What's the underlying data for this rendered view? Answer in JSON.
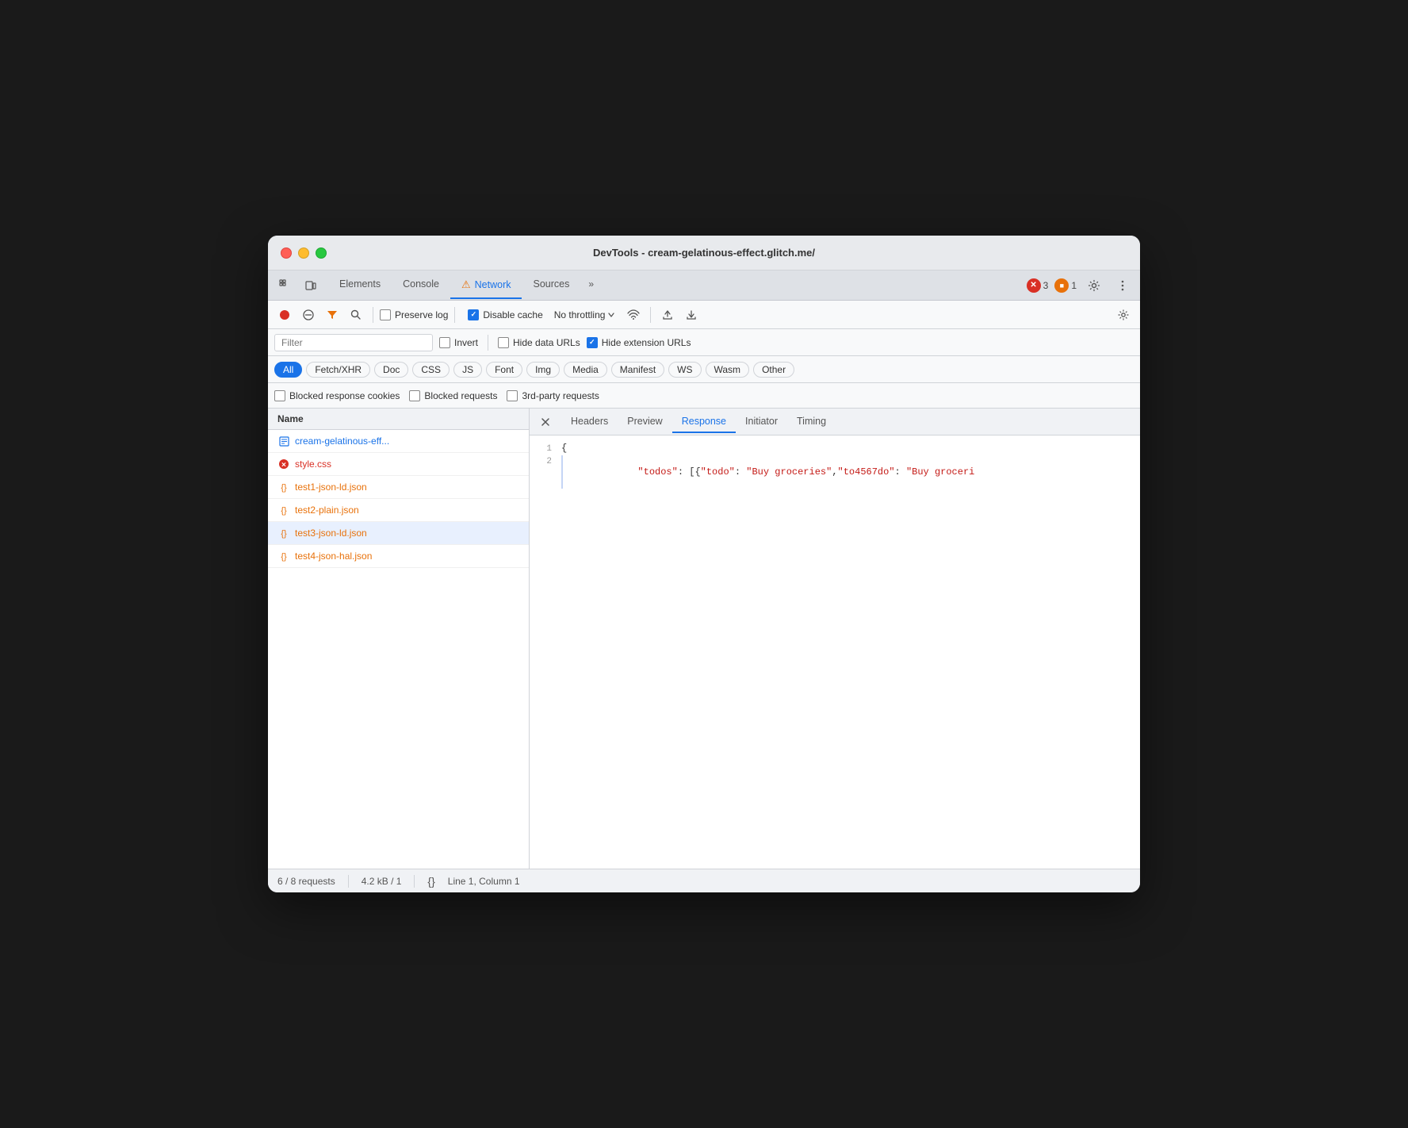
{
  "window": {
    "title": "DevTools - cream-gelatinous-effect.glitch.me/"
  },
  "tabs": {
    "items": [
      {
        "label": "Elements",
        "active": false
      },
      {
        "label": "Console",
        "active": false
      },
      {
        "label": "Network",
        "active": true
      },
      {
        "label": "Sources",
        "active": false
      }
    ],
    "more_label": "»",
    "error_count": "3",
    "warning_count": "1"
  },
  "toolbar": {
    "preserve_log": "Preserve log",
    "disable_cache": "Disable cache",
    "no_throttling": "No throttling",
    "preserve_log_checked": false,
    "disable_cache_checked": true
  },
  "filter_bar": {
    "filter_placeholder": "Filter",
    "invert_label": "Invert",
    "invert_checked": false,
    "hide_data_label": "Hide data URLs",
    "hide_data_checked": false,
    "hide_ext_label": "Hide extension URLs",
    "hide_ext_checked": true
  },
  "type_filters": {
    "items": [
      {
        "label": "All",
        "active": true
      },
      {
        "label": "Fetch/XHR",
        "active": false
      },
      {
        "label": "Doc",
        "active": false
      },
      {
        "label": "CSS",
        "active": false
      },
      {
        "label": "JS",
        "active": false
      },
      {
        "label": "Font",
        "active": false
      },
      {
        "label": "Img",
        "active": false
      },
      {
        "label": "Media",
        "active": false
      },
      {
        "label": "Manifest",
        "active": false
      },
      {
        "label": "WS",
        "active": false
      },
      {
        "label": "Wasm",
        "active": false
      },
      {
        "label": "Other",
        "active": false
      }
    ]
  },
  "extra_filters": {
    "blocked_cookies": "Blocked response cookies",
    "blocked_requests": "Blocked requests",
    "third_party": "3rd-party requests",
    "blocked_cookies_checked": false,
    "blocked_requests_checked": false,
    "third_party_checked": false
  },
  "file_list": {
    "header": "Name",
    "items": [
      {
        "name": "cream-gelatinous-eff...",
        "type": "doc",
        "selected": false
      },
      {
        "name": "style.css",
        "type": "error",
        "selected": false
      },
      {
        "name": "test1-json-ld.json",
        "type": "json",
        "selected": false
      },
      {
        "name": "test2-plain.json",
        "type": "json",
        "selected": false
      },
      {
        "name": "test3-json-ld.json",
        "type": "json",
        "selected": true
      },
      {
        "name": "test4-json-hal.json",
        "type": "json",
        "selected": false
      }
    ]
  },
  "response_panel": {
    "tabs": [
      {
        "label": "Headers",
        "active": false
      },
      {
        "label": "Preview",
        "active": false
      },
      {
        "label": "Response",
        "active": true
      },
      {
        "label": "Initiator",
        "active": false
      },
      {
        "label": "Timing",
        "active": false
      }
    ],
    "code_lines": [
      {
        "number": "1",
        "indent": false,
        "text": "{"
      },
      {
        "number": "2",
        "indent": true,
        "text": "  \"todos\": [{\"todo\": \"Buy groceries\",\"to4567do\": \"Buy groceri"
      }
    ]
  },
  "status_bar": {
    "requests": "6 / 8 requests",
    "size": "4.2 kB / 1",
    "position": "Line 1, Column 1"
  }
}
